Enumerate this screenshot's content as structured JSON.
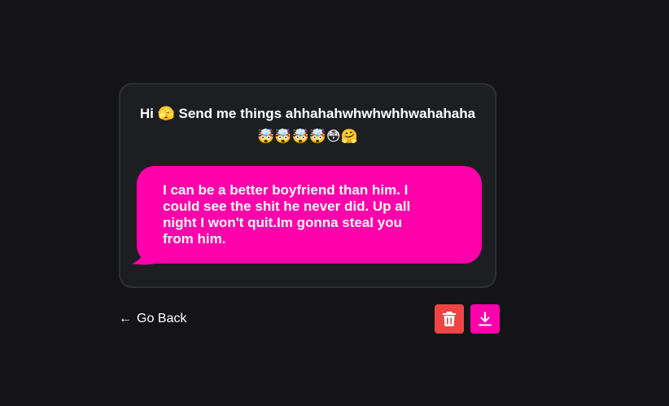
{
  "card": {
    "prompt": "Hi 🫣 Send me things ahhahahwhwhwhhwahahaha 🤯🤯🤯🤯😳🤗",
    "message": "I can be a better boyfriend than him. I could see the shit he never did. Up all night I won't quit.Im gonna steal you from him."
  },
  "nav": {
    "back_arrow": "←",
    "back_label": "Go Back"
  },
  "actions": {
    "delete_icon": "trash-icon",
    "download_icon": "download-icon"
  },
  "colors": {
    "background": "#141416",
    "card": "#1d1e22",
    "bubble": "#ff00aa",
    "delete": "#ef4444",
    "download": "#ff00aa"
  }
}
